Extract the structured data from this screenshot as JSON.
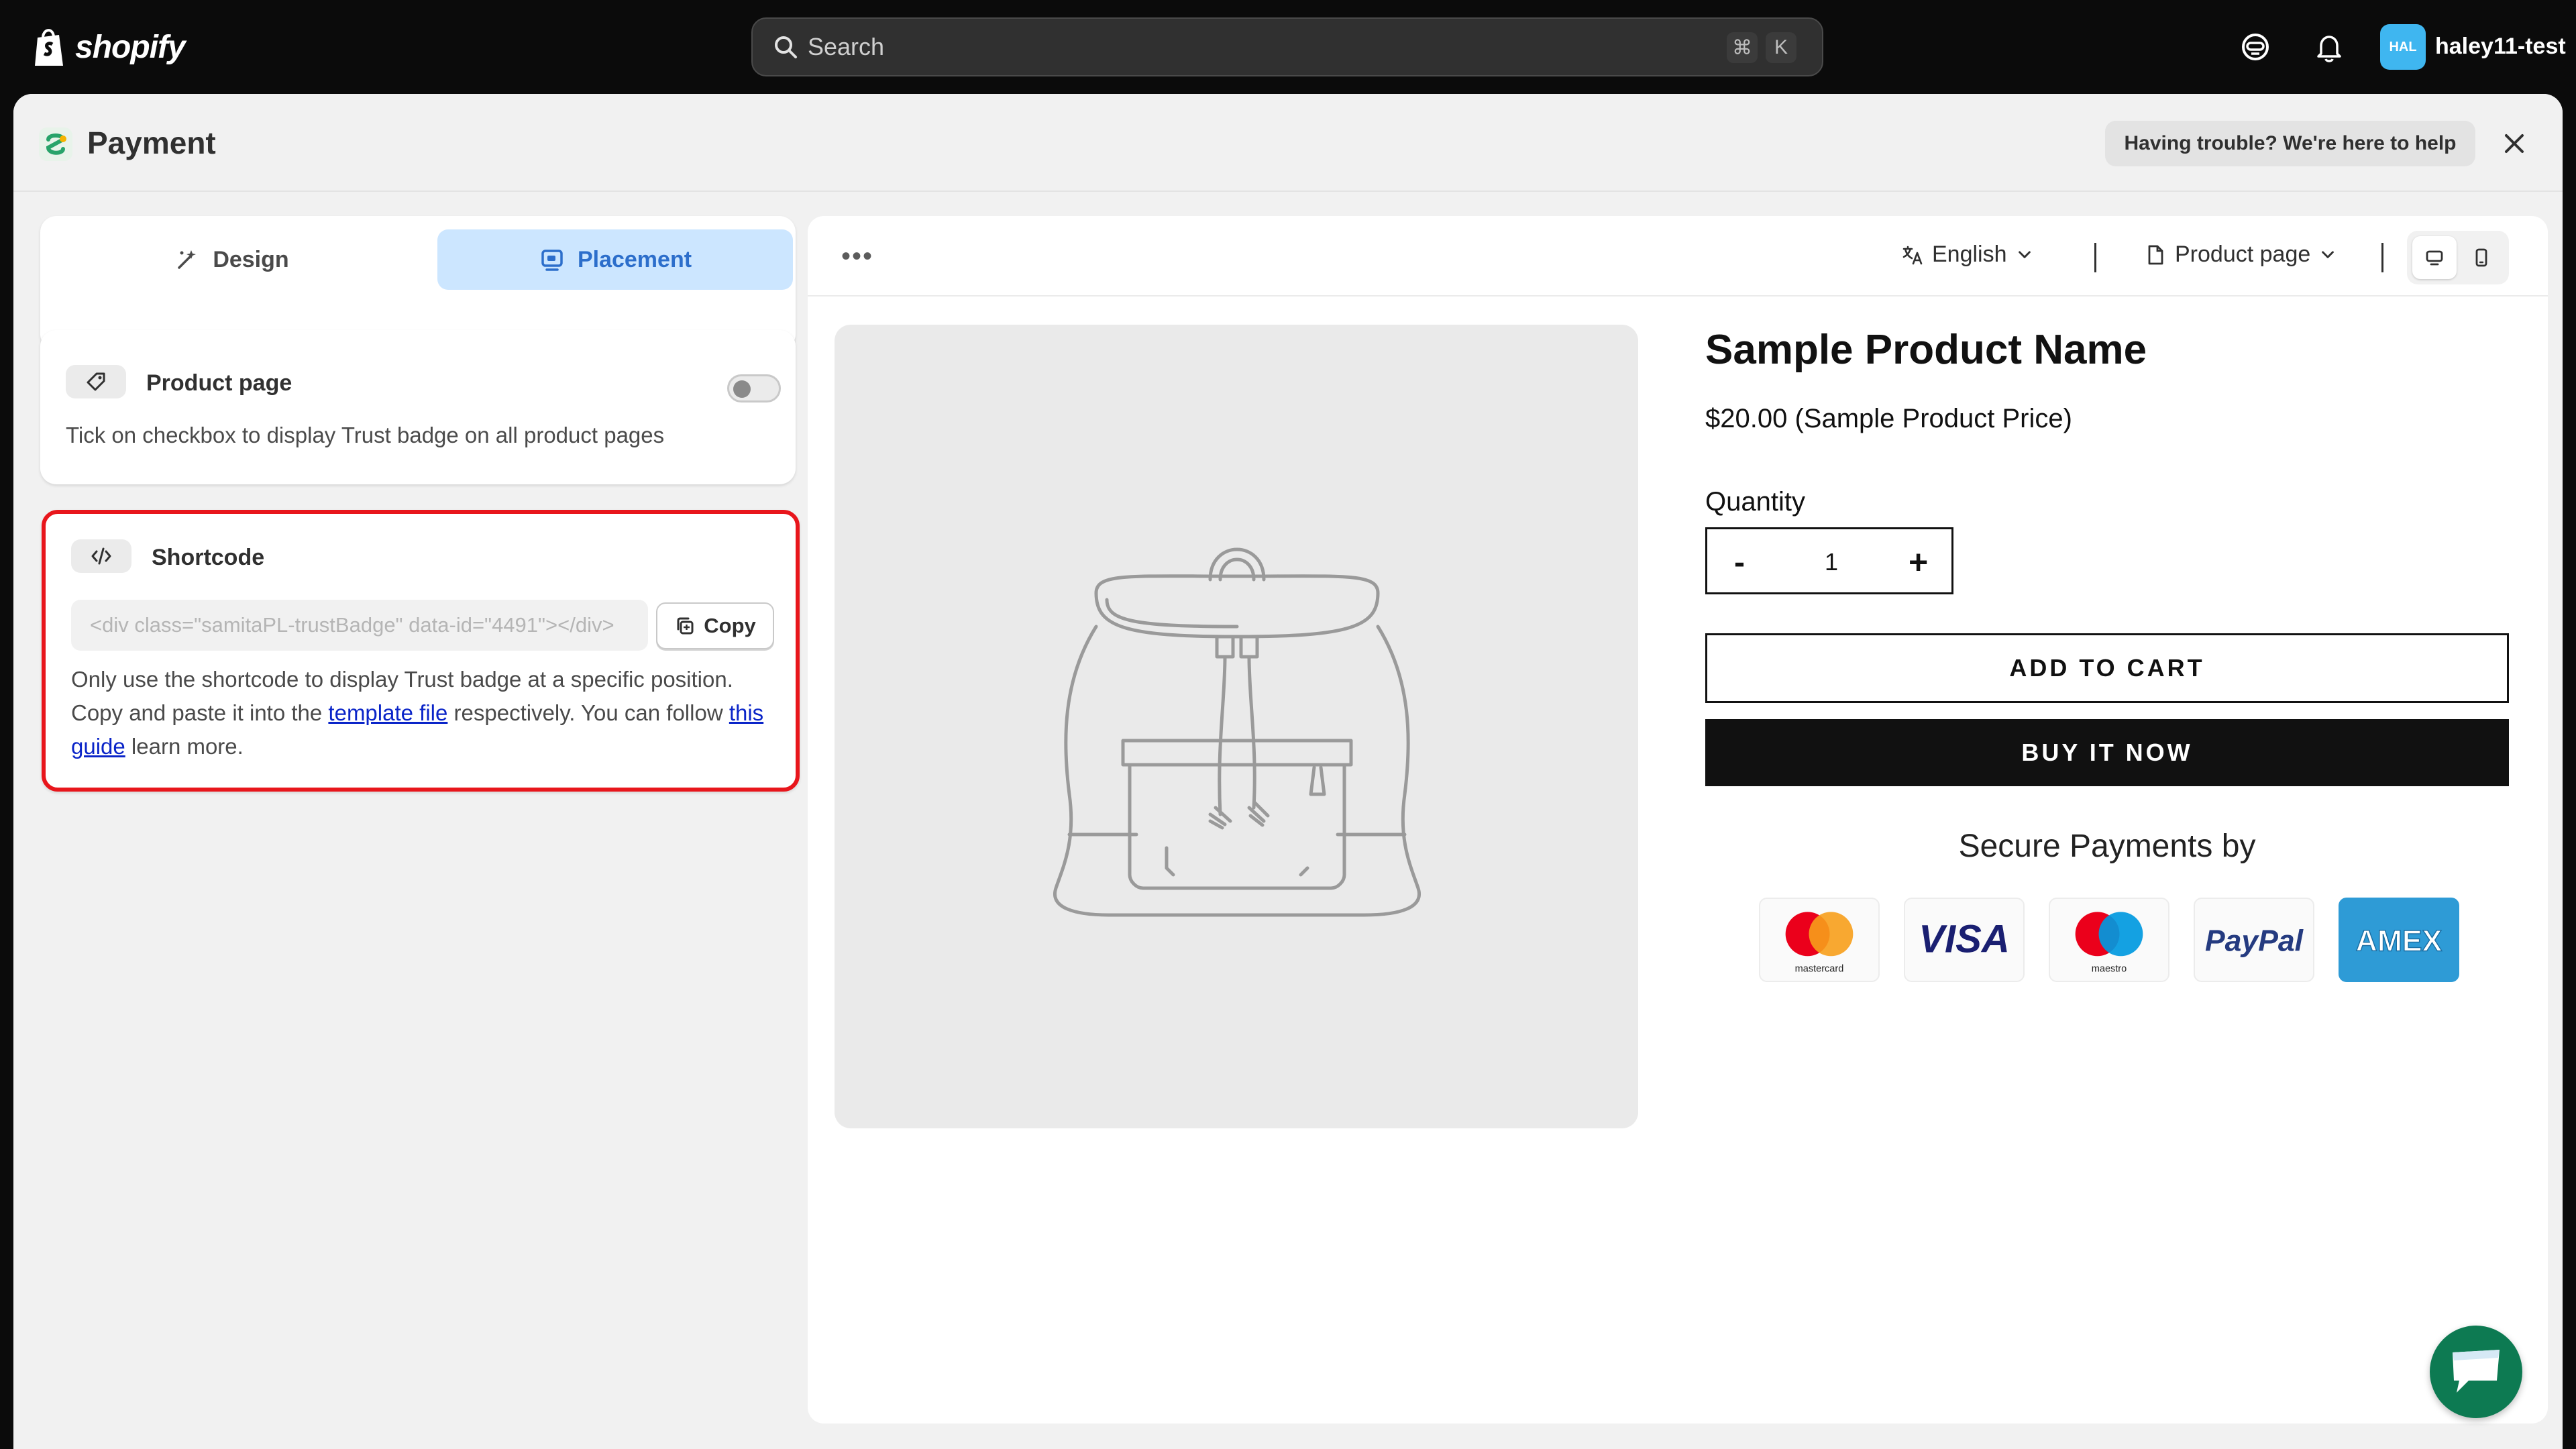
{
  "topbar": {
    "brand": "shopify",
    "search_placeholder": "Search",
    "shortcut_cmd": "⌘",
    "shortcut_key": "K",
    "avatar_initials": "HAL",
    "username": "haley11-test"
  },
  "window": {
    "title": "Payment",
    "help_label": "Having trouble? We're here to help"
  },
  "tabs": {
    "design": "Design",
    "placement": "Placement"
  },
  "product_card": {
    "title": "Product page",
    "description": "Tick on checkbox to display Trust badge on all product pages"
  },
  "shortcode_card": {
    "title": "Shortcode",
    "code_value": "<div class=\"samitaPL-trustBadge\" data-id=\"4491\"></div>",
    "copy_label": "Copy",
    "desc_part1": "Only use the shortcode to display Trust badge at a specific position. Copy and paste it into the ",
    "link_template": "template file",
    "desc_part2": " respectively. You can follow ",
    "link_guide": "this guide",
    "desc_part3": " learn more."
  },
  "preview": {
    "language": "English",
    "page": "Product page",
    "product_name": "Sample Product Name",
    "product_price": "$20.00 (Sample Product Price)",
    "quantity_label": "Quantity",
    "quantity_minus": "-",
    "quantity_value": "1",
    "quantity_plus": "+",
    "add_to_cart": "ADD TO CART",
    "buy_now": "BUY IT NOW",
    "secure_title": "Secure Payments by",
    "badges": [
      {
        "name": "mastercard",
        "caption": "mastercard"
      },
      {
        "name": "visa",
        "text": "VISA"
      },
      {
        "name": "maestro",
        "caption": "maestro"
      },
      {
        "name": "paypal",
        "text": "PayPal"
      },
      {
        "name": "amex",
        "text": "AMEX"
      }
    ]
  },
  "colors": {
    "accent_blue": "#2c6ecb",
    "placement_tab_bg": "#cce6ff",
    "highlight_red": "#e8161c",
    "chat_green": "#0d7a52"
  }
}
